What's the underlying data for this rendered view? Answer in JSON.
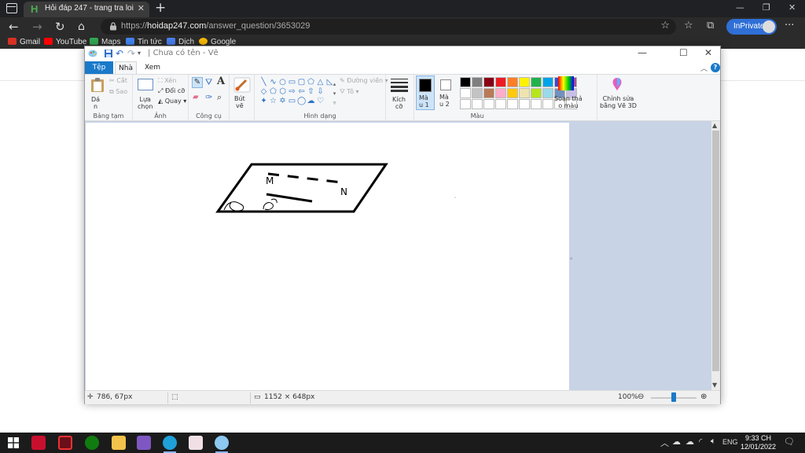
{
  "browser": {
    "tab_title": "Hỏi đáp 247 - trang tra loi",
    "favicon_letter": "H",
    "url_domain": "hoidap247.com",
    "url_scheme": "https://",
    "url_path": "/answer_question/3653029",
    "inprivate_label": "InPrivate",
    "bookmarks": [
      {
        "label": "Gmail",
        "color": "#d93025"
      },
      {
        "label": "YouTube",
        "color": "#ff0000"
      },
      {
        "label": "Maps",
        "color": "#34a853"
      },
      {
        "label": "Tin tức",
        "color": "#4285f4"
      },
      {
        "label": "Dịch",
        "color": "#4a7ef0"
      },
      {
        "label": "Google",
        "color": "#fbbc05"
      }
    ]
  },
  "paint": {
    "title": "Chưa có tên - Vẽ",
    "tabs": {
      "file": "Tệp",
      "home": "Nhà",
      "view": "Xem"
    },
    "clipboard": {
      "paste": "Dá\nn",
      "cut": "Cắt",
      "copy": "Sao",
      "label": "Bảng tạm"
    },
    "image": {
      "select": "Lựa\nchọn",
      "crop": "Xén",
      "resize": "Đổi cỡ",
      "rotate": "Quay",
      "label": "Ảnh"
    },
    "tools": {
      "label": "Công cụ"
    },
    "brushes": {
      "label": "Bút\nvẽ"
    },
    "shapes": {
      "outline": "Đường viền",
      "fill": "Tô",
      "label": "Hình dạng"
    },
    "size": {
      "label": "Kích\ncỡ"
    },
    "colors": {
      "color1_label": "Mà\nu 1",
      "color2_label": "Mà\nu 2",
      "edit_label": "Soạn thả\no màu",
      "paint3d_label": "Chỉnh sửa\nbằng Vẽ 3D",
      "group_label": "Màu",
      "color1": "#000000",
      "color2": "#ffffff",
      "palette_row1": [
        "#000000",
        "#7f7f7f",
        "#880015",
        "#ed1c24",
        "#ff7f27",
        "#fff200",
        "#22b14c",
        "#00a2e8",
        "#3f48cc",
        "#a349a4"
      ],
      "palette_row2": [
        "#ffffff",
        "#c3c3c3",
        "#b97a57",
        "#ffaec9",
        "#ffc90e",
        "#efe4b0",
        "#b5e61d",
        "#99d9ea",
        "#7092be",
        "#c8bfe7"
      ]
    },
    "drawing": {
      "label_m": "M",
      "label_n": "N"
    },
    "status": {
      "cursor": "786, 67px",
      "canvas_size": "1152 × 648px",
      "zoom": "100%"
    }
  },
  "taskbar": {
    "lang": "ENG",
    "time": "9:33 CH",
    "date": "12/01/2022"
  }
}
